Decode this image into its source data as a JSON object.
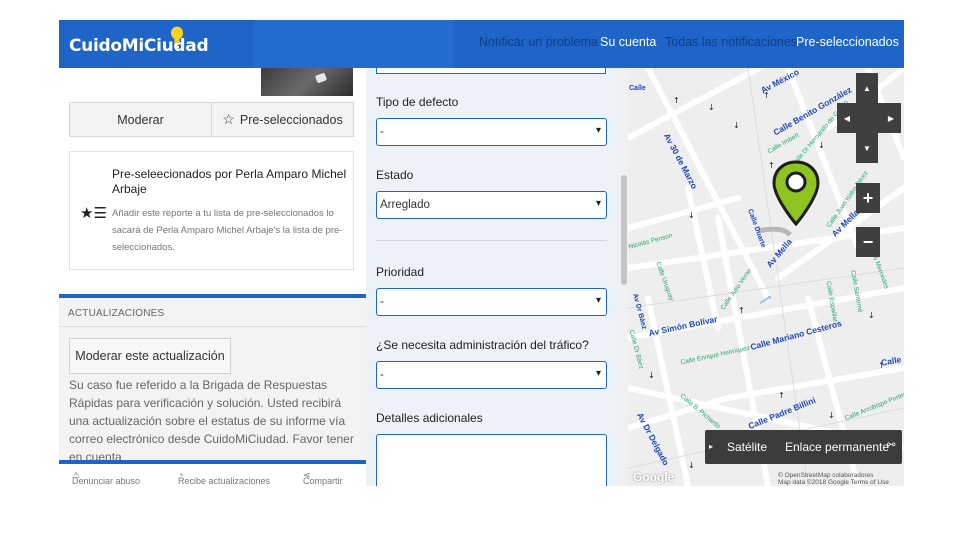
{
  "header": {
    "logo": "CuidoMiCiudad",
    "nav": [
      "Notificar un problema",
      "Su cuenta",
      "Todas las notificaciones",
      "Pre-seleccionados"
    ]
  },
  "left": {
    "moderate_btn": "Moderar",
    "preselect_btn": "Pre-seleccionados",
    "preselect_title": "Pre-seleecionados por Perla Amparo Michel Arbaje",
    "preselect_desc": "Añadir este reporte a tu lista de pre-seleccionados lo sacará de Perla Amparo Michel Arbaje's la lista de pre-seleccionados.",
    "updates_label": "ACTUALIZACIONES",
    "moderate_update_btn": "Moderar este actualización",
    "update_text": "Su caso fue referido a la Brigada de Respuestas Rápidas para verificación y solución. Usted recibirá una actualización sobre el estatus de su informe vía correo electrónico desde CuidoMiCiudad. Favor tener en cuenta",
    "footer": [
      "Denunciar abuso",
      "Recibe actualizaciones",
      "Compartir"
    ]
  },
  "form": {
    "defect_label": "Tipo de defecto",
    "defect_value": "-",
    "state_label": "Estado",
    "state_value": "Arreglado",
    "priority_label": "Prioridad",
    "priority_value": "-",
    "traffic_label": "¿Se necesita administración del tráfico?",
    "traffic_value": "-",
    "details_label": "Detalles adicionales"
  },
  "map": {
    "streets_blue": [
      "Av México",
      "Calle Benito González",
      "Av 30 de Marzo",
      "Av Mella",
      "Av Mella",
      "Av Simón Bolívar",
      "Calle Mariano Cesteros",
      "Calle Padre Billini",
      "Calle",
      "Av Dr Delgado",
      "Av Dr Báez",
      "Calle Duarte",
      "Calle"
    ],
    "streets_green": [
      "Calle Imbert",
      "Calle Dr Hernando de Gorjón",
      "Calle Juan Isidro Pérez",
      "Calle Espaillat",
      "Calle Santomé",
      "Calle Julio Verne",
      "Calle Uruguay",
      "Nicolás Penson",
      "Calle Enrique Henríquez",
      "Calle B. Pichardo",
      "Calle Arzobispo Portes",
      "Calle Dr Báez",
      "Calle Las Mercedes"
    ],
    "satellite": "Satélite",
    "permalink": "Enlace permanente",
    "attribution_1": "© OpenStreetMap colaboradores",
    "attribution_2": "Map data ©2018 Google   Terms of Use",
    "google": "Google",
    "pin_color": "#8fc31f"
  },
  "colors": {
    "brand": "#1f64c7"
  }
}
